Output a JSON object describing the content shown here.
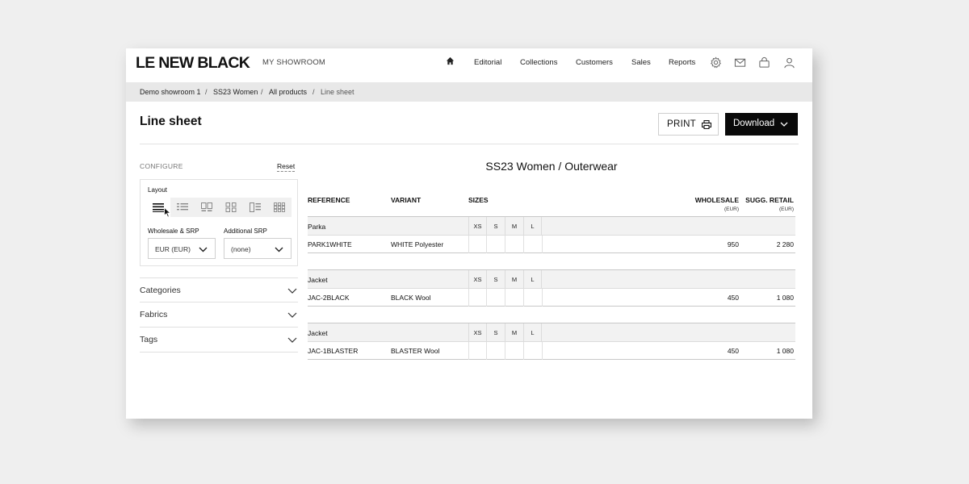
{
  "brand": "LE NEW BLACK",
  "showroom_label": "MY SHOWROOM",
  "nav": {
    "home_icon": "home-icon",
    "links": [
      "Editorial",
      "Collections",
      "Customers",
      "Sales",
      "Reports"
    ],
    "icons": [
      "gear-icon",
      "mail-icon",
      "bag-icon",
      "user-icon"
    ]
  },
  "breadcrumb": [
    "Demo showroom 1",
    "SS23 Women",
    "All products",
    "Line sheet"
  ],
  "page_title": "Line sheet",
  "buttons": {
    "print": "PRINT",
    "download": "Download"
  },
  "configure": {
    "title": "CONFIGURE",
    "reset": "Reset",
    "layout_label": "Layout",
    "layout_options": [
      "list-layout-icon",
      "detail-list-layout-icon",
      "two-column-layout-icon",
      "grid-layout-icon",
      "side-image-layout-icon",
      "dense-grid-layout-icon"
    ],
    "selected_layout": 0,
    "wholesale_label": "Wholesale & SRP",
    "wholesale_value": "EUR (EUR)",
    "additional_label": "Additional SRP",
    "additional_value": "(none)"
  },
  "filters": [
    "Categories",
    "Fabrics",
    "Tags"
  ],
  "sheet": {
    "title": "SS23 Women / Outerwear",
    "columns": {
      "reference": "REFERENCE",
      "variant": "VARIANT",
      "sizes": "SIZES",
      "wholesale": "WHOLESALE",
      "wholesale_unit": "(EUR)",
      "retail": "SUGG. RETAIL",
      "retail_unit": "(EUR)"
    },
    "size_labels": [
      "XS",
      "S",
      "M",
      "L"
    ],
    "groups": [
      {
        "category": "Parka",
        "reference": "PARK1WHITE",
        "variant": "WHITE Polyester",
        "wholesale": "950",
        "retail": "2 280"
      },
      {
        "category": "Jacket",
        "reference": "JAC-2BLACK",
        "variant": "BLACK Wool",
        "wholesale": "450",
        "retail": "1 080"
      },
      {
        "category": "Jacket",
        "reference": "JAC-1BLASTER",
        "variant": "BLASTER Wool",
        "wholesale": "450",
        "retail": "1 080"
      }
    ]
  }
}
